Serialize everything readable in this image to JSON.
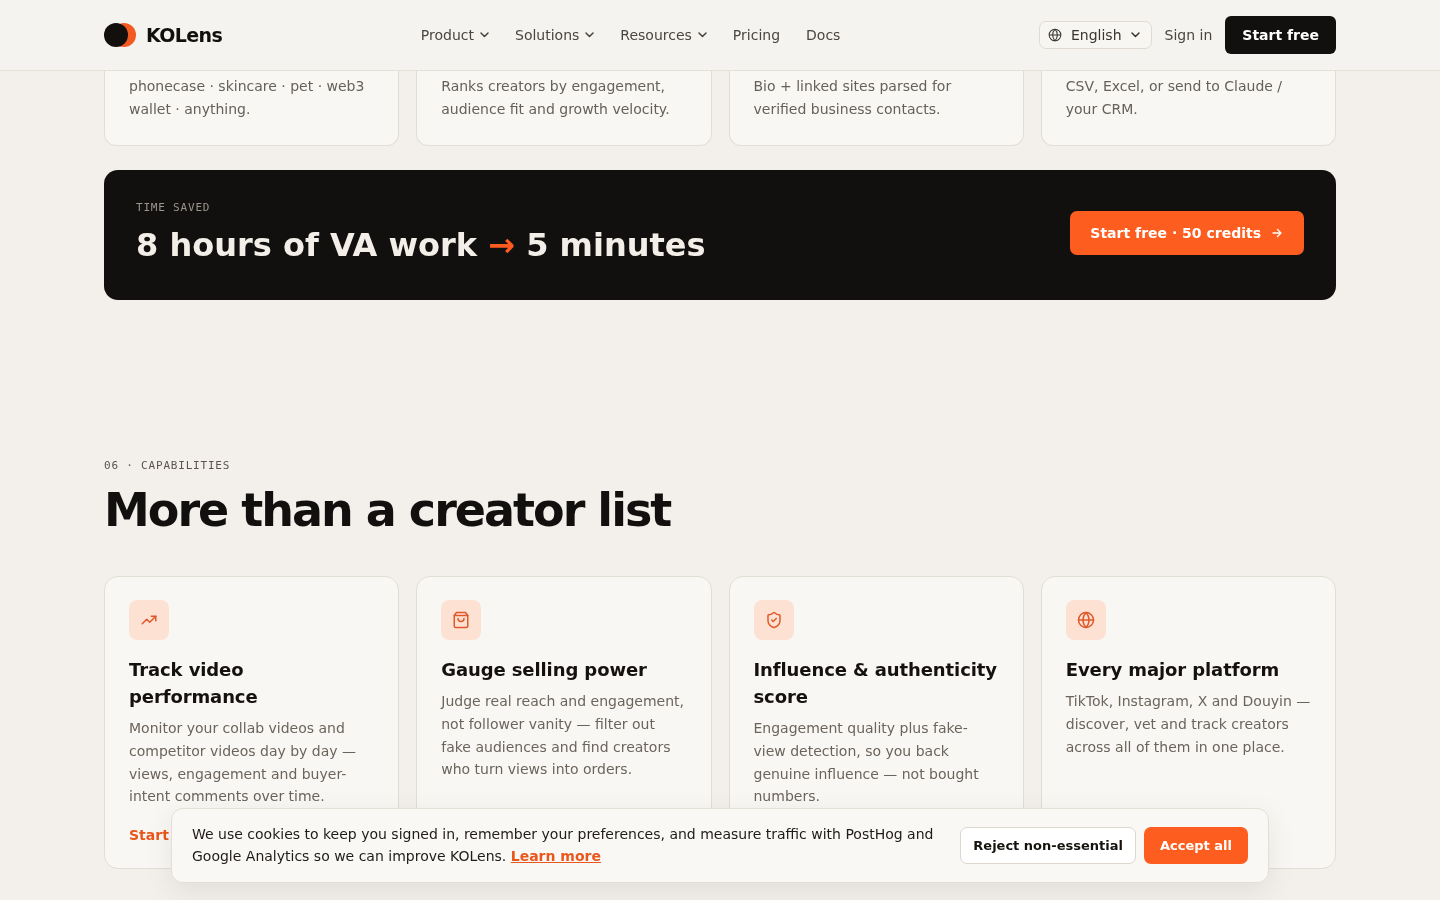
{
  "header": {
    "brand": "KOLens",
    "nav": [
      {
        "label": "Product",
        "dropdown": true
      },
      {
        "label": "Solutions",
        "dropdown": true
      },
      {
        "label": "Resources",
        "dropdown": true
      },
      {
        "label": "Pricing",
        "dropdown": false
      },
      {
        "label": "Docs",
        "dropdown": false
      }
    ],
    "language": "English",
    "sign_in": "Sign in",
    "cta": "Start free"
  },
  "feature_cards": [
    {
      "description": "phonecase · skincare · pet · web3 wallet · anything."
    },
    {
      "description": "Ranks creators by engagement, audience fit and growth velocity."
    },
    {
      "description": "Bio + linked sites parsed for verified business contacts."
    },
    {
      "description": "CSV, Excel, or send to Claude / your CRM."
    }
  ],
  "banner": {
    "eyebrow": "TIME SAVED",
    "headline": {
      "start": "8 hours of VA work",
      "arrow": "→",
      "end": "5 minutes"
    },
    "button": "Start free · 50 credits"
  },
  "capabilities": {
    "eyebrow": "06 · CAPABILITIES",
    "title": "More than a creator list",
    "cards": [
      {
        "title": "Track video performance",
        "description": "Monitor your collab videos and competitor videos day by day — views, engagement and buyer-intent comments over time.",
        "link": "Start"
      },
      {
        "title": "Gauge selling power",
        "description": "Judge real reach and engagement, not follower vanity — filter out fake audiences and find creators who turn views into orders."
      },
      {
        "title": "Influence & authenticity score",
        "description": "Engagement quality plus fake-view detection, so you back genuine influence — not bought numbers."
      },
      {
        "title": "Every major platform",
        "description": "TikTok, Instagram, X and Douyin — discover, vet and track creators across all of them in one place."
      }
    ]
  },
  "cookie_banner": {
    "text": "We use cookies to keep you signed in, remember your preferences, and measure traffic with PostHog and Google Analytics so we can improve KOLens.",
    "link": "Learn more",
    "buttons": [
      {
        "label": "Reject non-essential",
        "kind": "reject"
      },
      {
        "label": "Accept all",
        "kind": "accept"
      }
    ]
  }
}
